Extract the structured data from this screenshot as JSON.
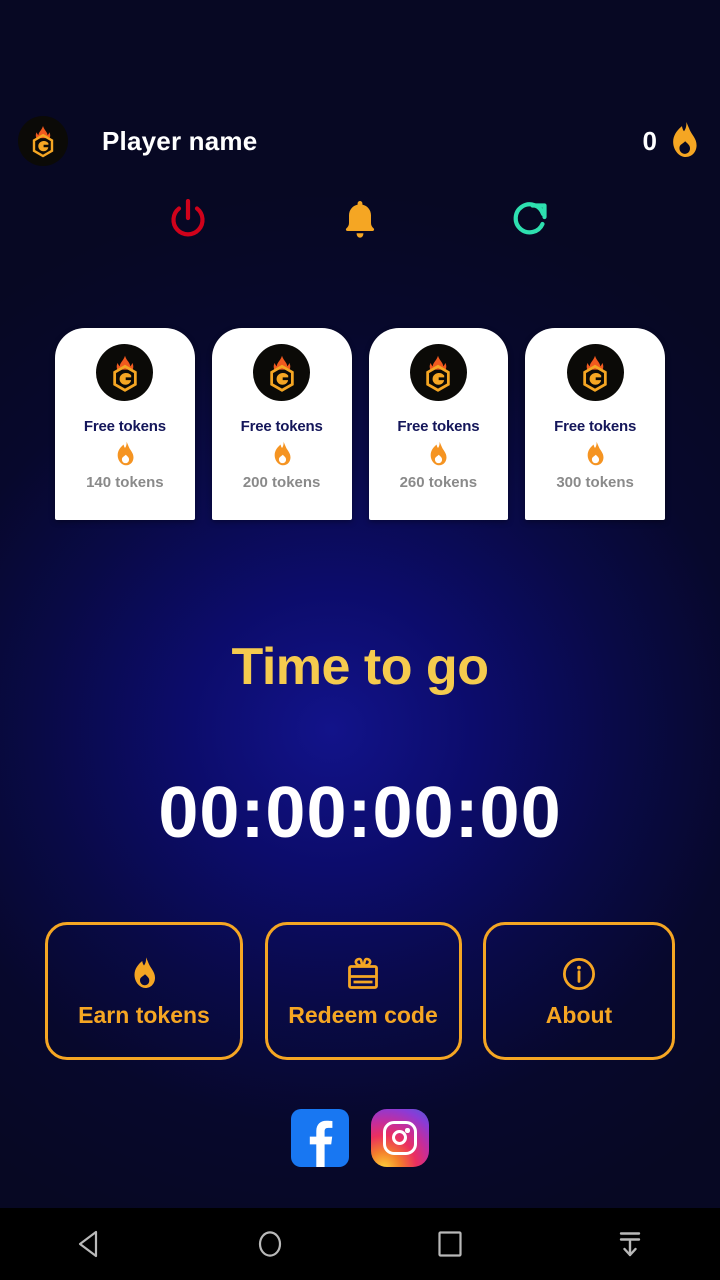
{
  "app": {
    "background_top": "#080a22",
    "background_center": "#0c0c6b",
    "accent_orange": "#f5a623",
    "accent_gold": "#f5cb4e"
  },
  "header": {
    "avatar_icon": "game-logo-flame-g-icon",
    "player_name": "Player name",
    "token_count": "0",
    "token_icon": "flame-icon"
  },
  "actions": [
    {
      "name": "power-button",
      "icon": "power-icon",
      "color": "#d0021b"
    },
    {
      "name": "notifications-button",
      "icon": "bell-icon",
      "color": "#f5a623"
    },
    {
      "name": "refresh-button",
      "icon": "refresh-icon",
      "color": "#2ee0b0"
    }
  ],
  "offer_cards": [
    {
      "logo_icon": "game-logo-flame-g-icon",
      "title": "Free tokens",
      "flame_icon": "flame-icon",
      "amount": "140 tokens"
    },
    {
      "logo_icon": "game-logo-flame-g-icon",
      "title": "Free tokens",
      "flame_icon": "flame-icon",
      "amount": "200 tokens"
    },
    {
      "logo_icon": "game-logo-flame-g-icon",
      "title": "Free tokens",
      "flame_icon": "flame-icon",
      "amount": "260 tokens"
    },
    {
      "logo_icon": "game-logo-flame-g-icon",
      "title": "Free tokens",
      "flame_icon": "flame-icon",
      "amount": "300 tokens"
    }
  ],
  "countdown": {
    "label": "Time to go",
    "value": "00:00:00:00"
  },
  "menu": [
    {
      "label": "Earn tokens",
      "icon": "flame-icon"
    },
    {
      "label": "Redeem code",
      "icon": "gift-voucher-icon"
    },
    {
      "label": "About",
      "icon": "info-circle-icon"
    }
  ],
  "social": [
    {
      "name": "facebook-button",
      "icon": "facebook-icon"
    },
    {
      "name": "instagram-button",
      "icon": "instagram-icon"
    }
  ],
  "navbar": [
    {
      "name": "nav-back-button",
      "icon": "back-triangle-icon"
    },
    {
      "name": "nav-home-button",
      "icon": "home-circle-icon"
    },
    {
      "name": "nav-recents-button",
      "icon": "recents-square-icon"
    },
    {
      "name": "nav-hide-keyboard-button",
      "icon": "hide-keyboard-down-arrow-icon"
    }
  ]
}
